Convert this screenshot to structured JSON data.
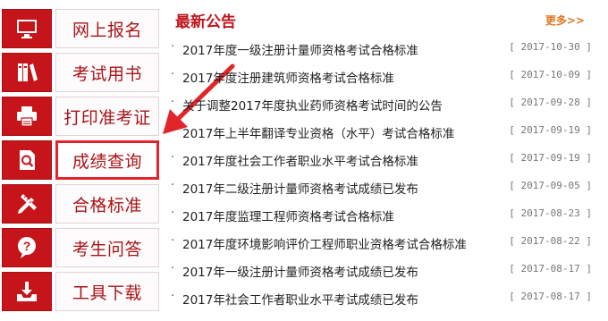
{
  "sidebar": {
    "items": [
      {
        "label": "网上报名",
        "icon": "monitor-icon"
      },
      {
        "label": "考试用书",
        "icon": "books-icon"
      },
      {
        "label": "打印准考证",
        "icon": "printer-icon"
      },
      {
        "label": "成绩查询",
        "icon": "search-document-icon"
      },
      {
        "label": "合格标准",
        "icon": "pencil-ruler-icon"
      },
      {
        "label": "考生问答",
        "icon": "question-bubble-icon"
      },
      {
        "label": "工具下载",
        "icon": "download-tray-icon"
      }
    ],
    "highlighted": "成绩查询"
  },
  "notices": {
    "title": "最新公告",
    "more_label": "更多>>",
    "bullet": "·",
    "items": [
      {
        "title": "2017年度一级注册计量师资格考试合格标准",
        "date": "[ 2017-10-30 ]"
      },
      {
        "title": "2017年度注册建筑师资格考试合格标准",
        "date": "[ 2017-10-09 ]"
      },
      {
        "title": "关于调整2017年度执业药师资格考试时间的公告",
        "date": "[ 2017-09-28 ]"
      },
      {
        "title": "2017年上半年翻译专业资格（水平）考试合格标准",
        "date": "[ 2017-09-19 ]"
      },
      {
        "title": "2017年度社会工作者职业水平考试合格标准",
        "date": "[ 2017-09-19 ]"
      },
      {
        "title": "2017年二级注册计量师资格考试成绩已发布",
        "date": "[ 2017-09-05 ]"
      },
      {
        "title": "2017年度监理工程师资格考试合格标准",
        "date": "[ 2017-08-23 ]"
      },
      {
        "title": "2017年度环境影响评价工程师职业资格考试合格标准",
        "date": "[ 2017-08-22 ]"
      },
      {
        "title": "2017年一级注册计量师资格考试成绩已发布",
        "date": "[ 2017-08-17 ]"
      },
      {
        "title": "2017年社会工作者职业水平考试成绩已发布",
        "date": "[ 2017-08-17 ]"
      }
    ]
  },
  "colors": {
    "brand_red": "#c5141a",
    "highlight_border": "#e2242b",
    "more_link": "#e07820"
  }
}
